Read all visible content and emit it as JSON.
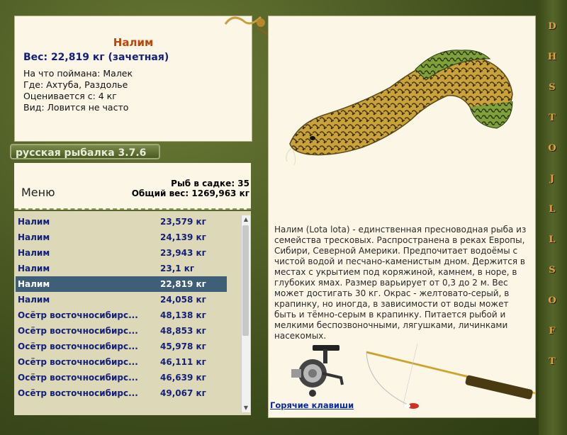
{
  "fish": {
    "name": "Налим",
    "weight_line": "Вес: 22,819 кг (зачетная)",
    "bait_line": "На что поймана: Малек",
    "place_line": "Где: Ахтуба, Раздолье",
    "value_line": "Оценивается с: 4 кг",
    "kind_line": "Вид: Ловится не часто"
  },
  "badge": "русская рыбалка 3.7.6",
  "menu": {
    "label": "Меню"
  },
  "stats": {
    "fish_count": "Рыб в садке: 35",
    "total_weight": "Общий вес: 1269,963 кг"
  },
  "catch_list": [
    {
      "name": "Налим",
      "weight": "23,579 кг"
    },
    {
      "name": "Налим",
      "weight": "24,139 кг"
    },
    {
      "name": "Налим",
      "weight": "23,943 кг"
    },
    {
      "name": "Налим",
      "weight": "23,1 кг"
    },
    {
      "name": "Налим",
      "weight": "22,819 кг",
      "selected": true
    },
    {
      "name": "Налим",
      "weight": "24,058 кг"
    },
    {
      "name": "Осётр восточносибирс...",
      "weight": "48,138 кг"
    },
    {
      "name": "Осётр восточносибирс...",
      "weight": "48,853 кг"
    },
    {
      "name": "Осётр восточносибирс...",
      "weight": "45,978 кг"
    },
    {
      "name": "Осётр восточносибирс...",
      "weight": "46,111 кг"
    },
    {
      "name": "Осётр восточносибирс...",
      "weight": "46,639 кг"
    },
    {
      "name": "Осётр восточносибирс...",
      "weight": "49,067 кг"
    }
  ],
  "description": "Налим (Lota lota) - единственная пресноводная рыба из семейства тресковых. Распространена в реках Европы, Сибири, Северной Америки. Предпочитает водоёмы с чистой водой и песчано-каменистым дном. Держится в местах с укрытием под коряжиной, камнем, в норе, в глубоких ямах. Размер варьирует от 0,3 до 2 м. Вес может достигать 30 кг. Окрас - желтовато-серый, в крапинку, но иногда, в зависимости от воды может быть и тёмно-серым в крапинку. Питается рыбой и мелкими беспозвоночными, лягушками, личинками насекомых.",
  "hotkeys_link": "Горячие клавиши",
  "vertical_strip": "DHSTOJLLSOFT",
  "colors": {
    "selected_row": "#3f5f79",
    "list_text": "#14207a",
    "title": "#c0450a"
  }
}
